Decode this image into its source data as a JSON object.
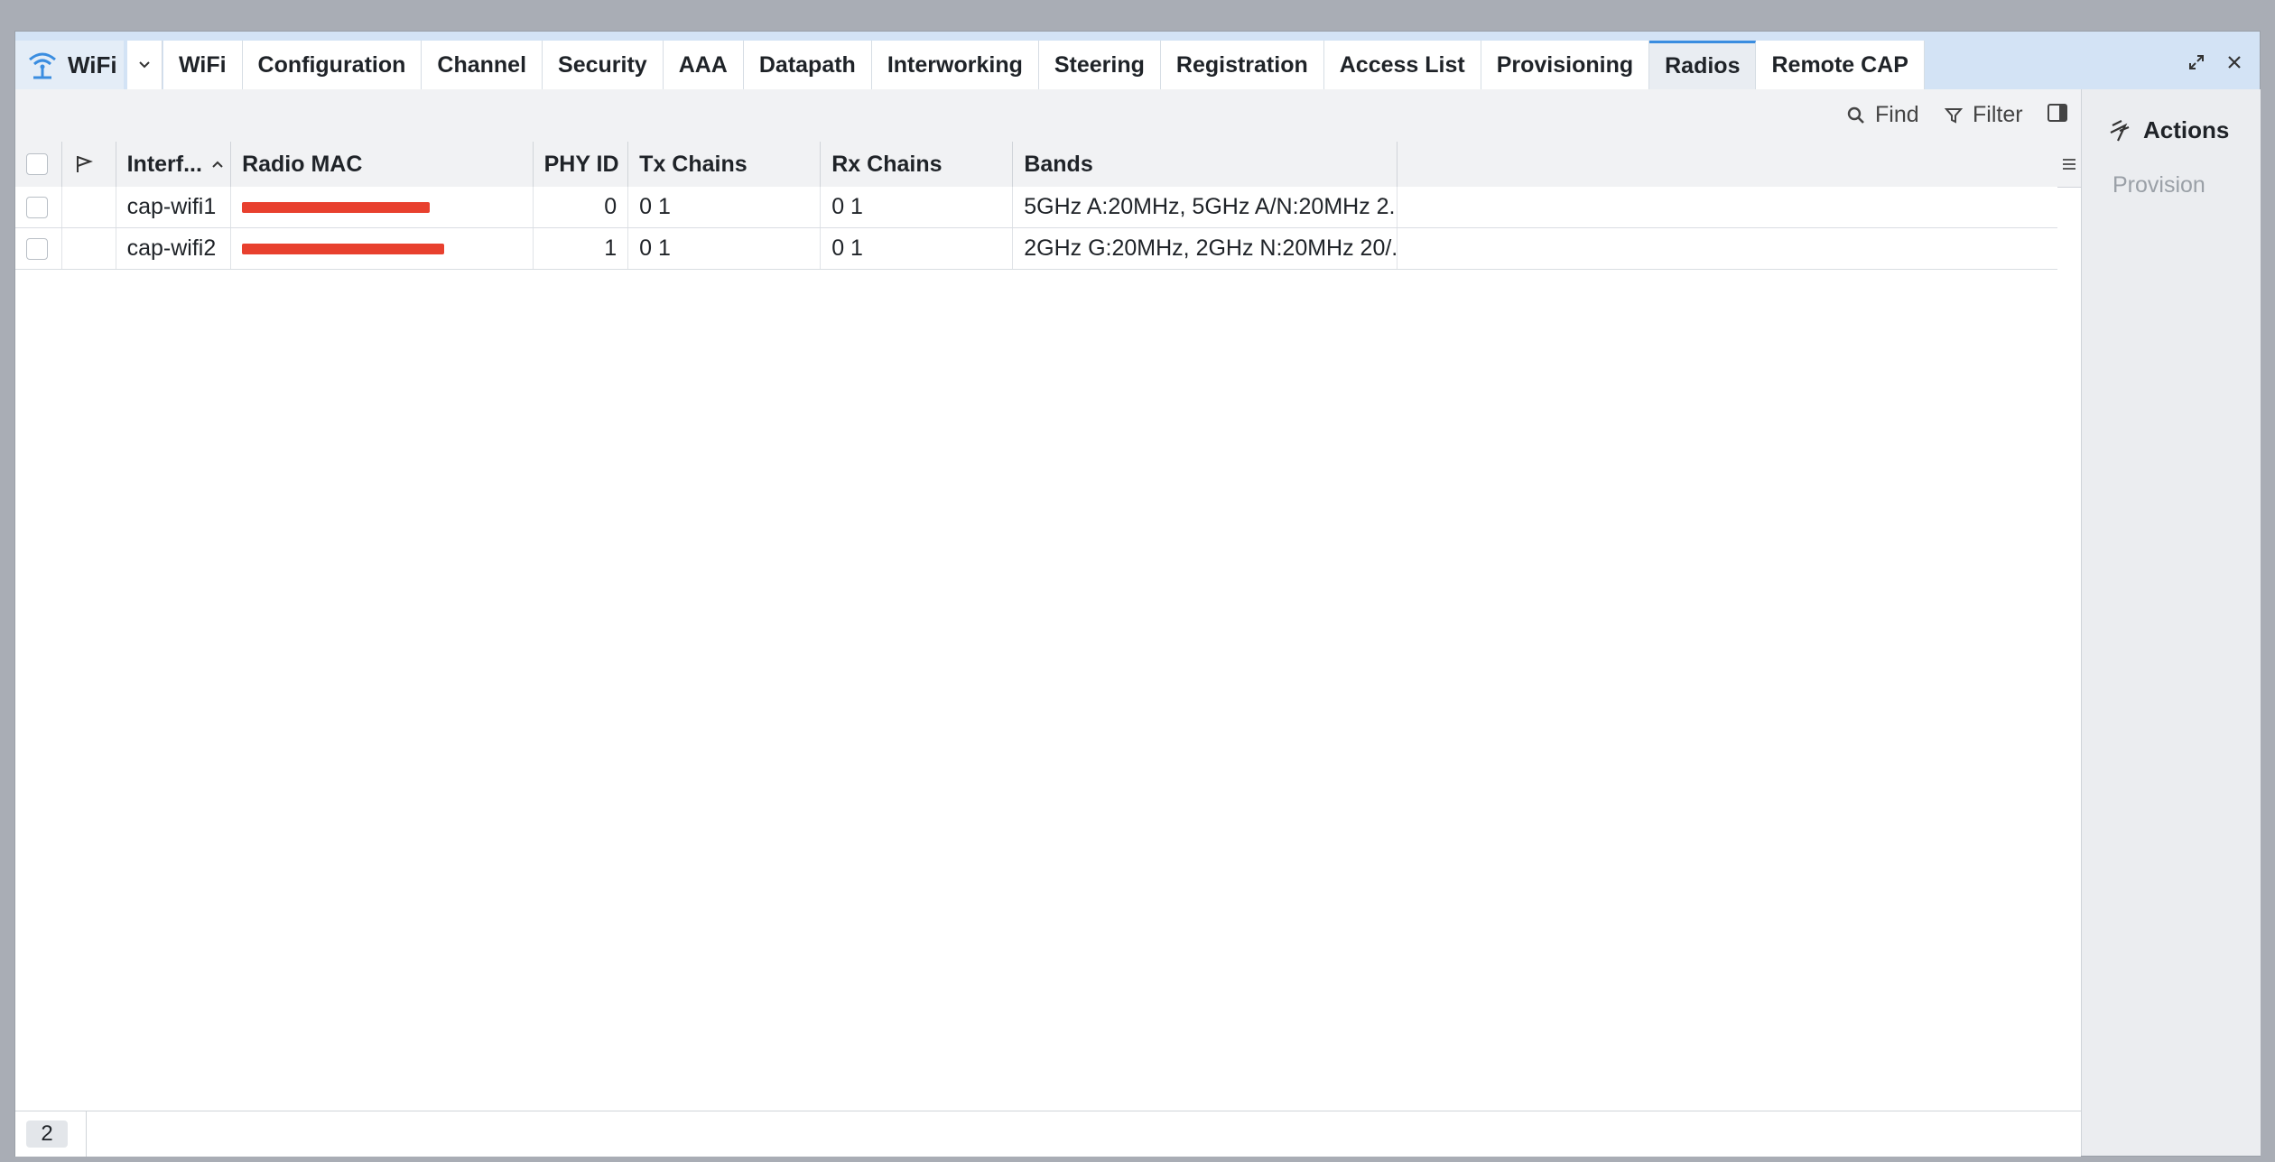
{
  "window": {
    "app_title": "WiFi",
    "icons": {
      "app": "wifi-icon",
      "dropdown": "chevron-down-icon",
      "maximize": "maximize-icon",
      "close": "close-icon"
    }
  },
  "tabs": [
    {
      "label": "WiFi",
      "active": false
    },
    {
      "label": "Configuration",
      "active": false
    },
    {
      "label": "Channel",
      "active": false
    },
    {
      "label": "Security",
      "active": false
    },
    {
      "label": "AAA",
      "active": false
    },
    {
      "label": "Datapath",
      "active": false
    },
    {
      "label": "Interworking",
      "active": false
    },
    {
      "label": "Steering",
      "active": false
    },
    {
      "label": "Registration",
      "active": false
    },
    {
      "label": "Access List",
      "active": false
    },
    {
      "label": "Provisioning",
      "active": false
    },
    {
      "label": "Radios",
      "active": true
    },
    {
      "label": "Remote CAP",
      "active": false
    }
  ],
  "toolbar": {
    "find_label": "Find",
    "filter_label": "Filter",
    "icons": {
      "find": "search-icon",
      "filter": "filter-icon",
      "panel": "side-panel-icon"
    }
  },
  "table": {
    "headers": {
      "interface": "Interf...",
      "radio_mac": "Radio MAC",
      "phy_id": "PHY ID",
      "tx_chains": "Tx Chains",
      "rx_chains": "Rx Chains",
      "bands": "Bands"
    },
    "sort": {
      "column": "interface",
      "direction": "ascending"
    },
    "rows": [
      {
        "interface": "cap-wifi1",
        "radio_mac": "",
        "radio_mac_redacted": true,
        "phy_id": "0",
        "tx_chains": "0 1",
        "rx_chains": "0 1",
        "bands": "5GHz A:20MHz, 5GHz A/N:20MHz 2..."
      },
      {
        "interface": "cap-wifi2",
        "radio_mac": "",
        "radio_mac_redacted": true,
        "phy_id": "1",
        "tx_chains": "0 1",
        "rx_chains": "0 1",
        "bands": "2GHz G:20MHz, 2GHz N:20MHz 20/..."
      }
    ]
  },
  "footer": {
    "count": "2"
  },
  "actions": {
    "title": "Actions",
    "items": [
      {
        "label": "Provision",
        "enabled": false
      }
    ]
  },
  "colors": {
    "accent": "#3a8de0",
    "tabbar_bg": "#d3e3f5",
    "redaction": "#e8402e"
  }
}
